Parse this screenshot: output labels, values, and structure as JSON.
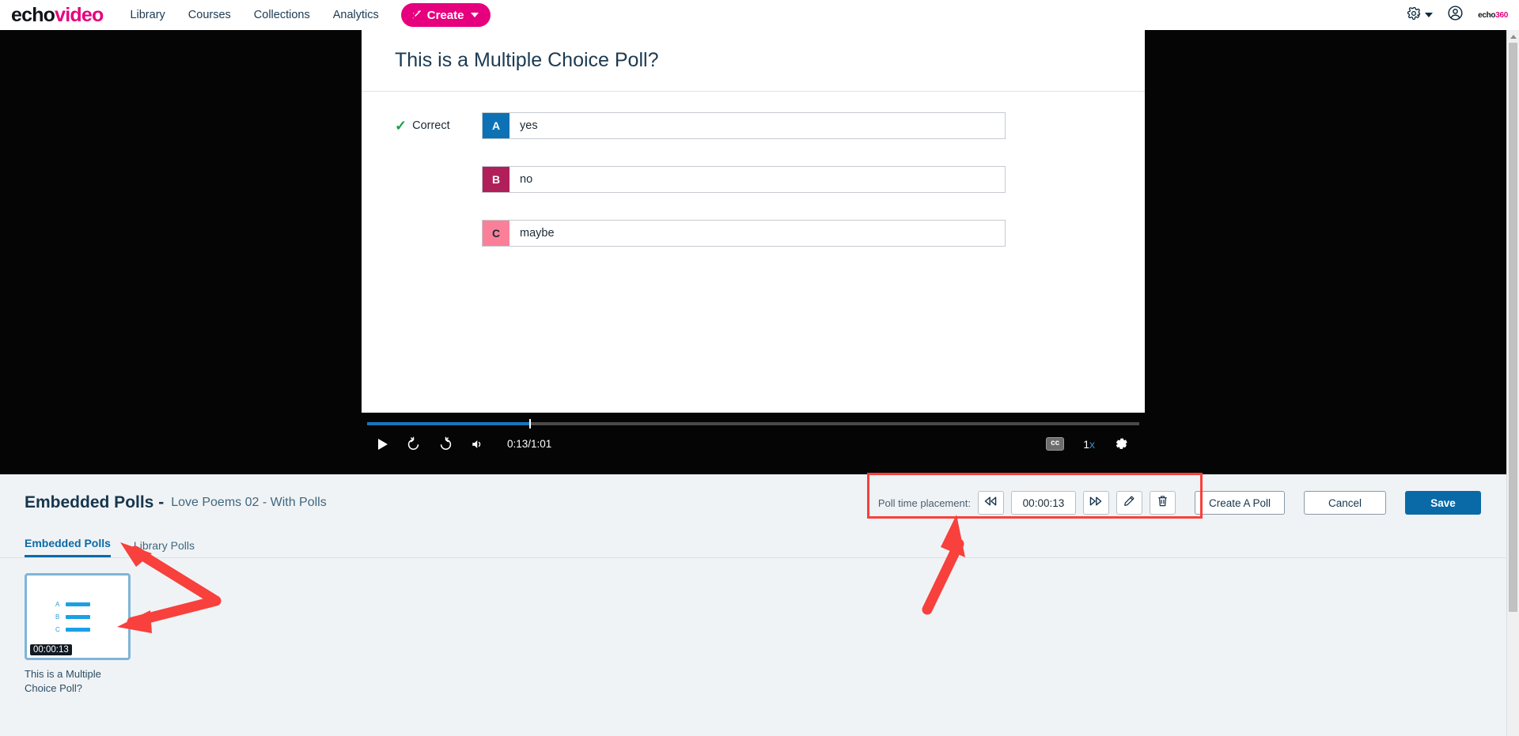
{
  "navbar": {
    "brand_echo": "echo",
    "brand_video": "video",
    "links": [
      {
        "label": "Library"
      },
      {
        "label": "Courses"
      },
      {
        "label": "Collections"
      },
      {
        "label": "Analytics"
      }
    ],
    "create_label": "Create",
    "create_icon": "wand-icon",
    "gear_icon": "gear-icon",
    "account_icon": "account-circle-icon",
    "corner_logo_echo": "echo",
    "corner_logo_num": "360",
    "accent_pink": "#e6007e"
  },
  "poll": {
    "question": "This is a Multiple Choice Poll?",
    "correct_label": "Correct",
    "check_icon": "check-icon",
    "answers": [
      {
        "letter": "A",
        "text": "yes",
        "color": "#0c72b5",
        "letter_color": "#ffffff",
        "correct": true
      },
      {
        "letter": "B",
        "text": "no",
        "color": "#b01f5a",
        "letter_color": "#ffffff",
        "correct": false
      },
      {
        "letter": "C",
        "text": "maybe",
        "color": "#fa8099",
        "letter_color": "#1b2a36",
        "correct": false
      }
    ]
  },
  "player": {
    "play_icon": "play-icon",
    "rewind_icon": "rewind-10-icon",
    "forward_icon": "forward-30-icon",
    "volume_icon": "volume-icon",
    "time_display": "0:13/1:01",
    "cc_label": "cc",
    "speed_num": "1",
    "speed_unit": "x",
    "settings_icon": "gear-icon",
    "progress_percent": 21,
    "progress_color": "#1477be"
  },
  "lower": {
    "title": "Embedded Polls -",
    "subtitle": "Love Poems 02 - With Polls",
    "time_placement": {
      "label": "Poll time placement:",
      "step_back_icon": "rewind-double-icon",
      "value": "00:00:13",
      "step_forward_icon": "forward-double-icon",
      "edit_icon": "pencil-icon",
      "delete_icon": "trash-icon"
    },
    "buttons": {
      "create": "Create A Poll",
      "cancel": "Cancel",
      "save": "Save",
      "save_color": "#0a6aa8"
    },
    "tabs": [
      {
        "label": "Embedded Polls",
        "active": true
      },
      {
        "label": "Library Polls",
        "active": false
      }
    ],
    "poll_cards": [
      {
        "rows": [
          "A",
          "B",
          "C"
        ],
        "timestamp": "00:00:13",
        "caption": "This is a Multiple Choice Poll?",
        "selected": true
      }
    ]
  },
  "annotations": {
    "highlight_color": "#f8403c",
    "box_target": "poll-time-placement-toolbar",
    "arrows": [
      {
        "name": "arrow-to-tabs-and-thumbnail",
        "kind": "double"
      },
      {
        "name": "arrow-to-time-placement",
        "kind": "single"
      }
    ]
  },
  "scrollbar": {
    "up_arrow_icon": "caret-up-icon"
  }
}
